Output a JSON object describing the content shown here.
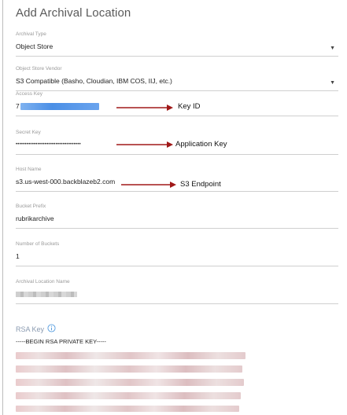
{
  "dialog": {
    "title": "Add Archival Location"
  },
  "fields": {
    "archival_type": {
      "label": "Archival Type",
      "value": "Object Store"
    },
    "vendor": {
      "label": "Object Store Vendor",
      "value": "S3 Compatible (Basho, Cloudian, IBM COS, IIJ, etc.)"
    },
    "access_key": {
      "label": "Access Key",
      "prefix": "7"
    },
    "secret_key": {
      "label": "Secret Key",
      "value": "••••••••••••••••••••••••••••••••••••"
    },
    "host_name": {
      "label": "Host Name",
      "value": "s3.us-west-000.backblazeb2.com"
    },
    "bucket_prefix": {
      "label": "Bucket Prefix",
      "value": "rubrikarchive"
    },
    "number_of_buckets": {
      "label": "Number of Buckets",
      "value": "1"
    },
    "archival_location_name": {
      "label": "Archival Location Name"
    }
  },
  "rsa": {
    "label": "RSA Key",
    "first_line": "-----BEGIN RSA PRIVATE KEY-----"
  },
  "annotations": {
    "key_id": "Key ID",
    "application_key": "Application Key",
    "s3_endpoint": "S3 Endpoint",
    "arrow_color": "#a01818"
  },
  "icons": {
    "dropdown": "caret-down-icon",
    "info": "info-icon"
  },
  "colors": {
    "accent_blue": "#5a9fe0",
    "annotation_red": "#a01818"
  }
}
